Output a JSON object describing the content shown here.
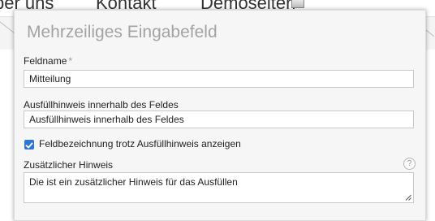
{
  "background_nav": {
    "items": [
      "ber uns",
      "Kontakt",
      "Demoseiten"
    ]
  },
  "panel": {
    "title": "Mehrzeiliges Eingabefeld",
    "fields": {
      "feldname": {
        "label": "Feldname",
        "required_marker": "*",
        "value": "Mitteilung"
      },
      "placeholder_hint": {
        "label": "Ausfüllhinweis innerhalb des Feldes",
        "value": "Ausfüllhinweis innerhalb des Feldes"
      },
      "show_label_checkbox": {
        "label": "Feldbezeichnung trotz Ausfüllhinweis anzeigen",
        "checked": true
      },
      "additional_hint": {
        "label": "Zusätzlicher Hinweis",
        "help_icon": "?",
        "value": "Die ist ein zusätzlicher Hinweis für das Ausfüllen"
      }
    }
  },
  "colors": {
    "checkbox_accent": "#2f76d2",
    "title_gray": "#a3a3a3",
    "panel_bg": "#f6f6f6"
  }
}
